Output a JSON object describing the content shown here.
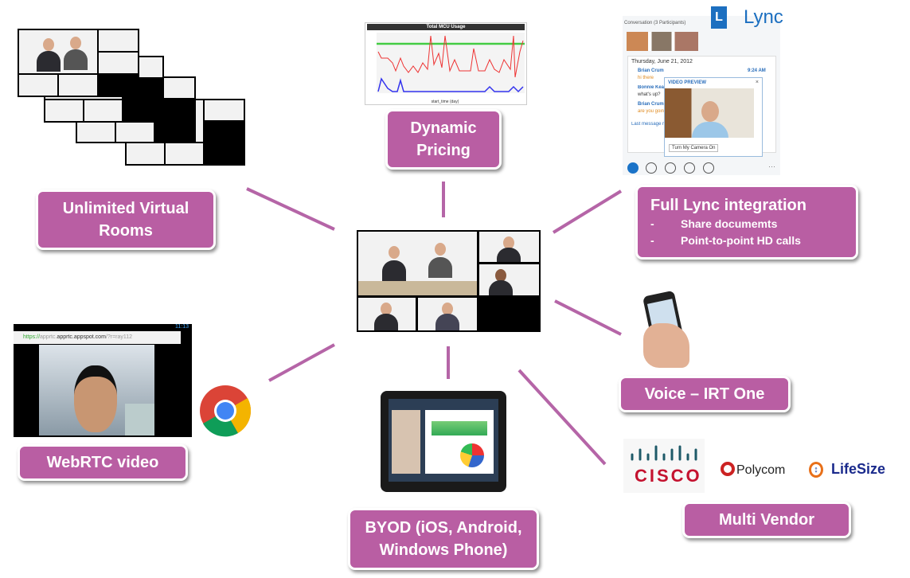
{
  "center": {
    "name": "video-conference-grid"
  },
  "labels": {
    "virtual_rooms": "Unlimited Virtual Rooms",
    "pricing": "Dynamic Pricing",
    "lync_title": "Full Lync integration",
    "lync_items": [
      "Share documemts",
      "Point-to-point HD calls"
    ],
    "lync_bullet": "-",
    "voice": "Voice – IRT One",
    "webrtc": "WebRTC video",
    "byod": "BYOD (iOS, Android, Windows Phone)",
    "multivendor": "Multi Vendor"
  },
  "chart": {
    "title": "Total MCU Usage",
    "xlabel": "start_time (day)",
    "yticks": [
      "12.5",
      "10.0",
      "7.5",
      "5.0",
      "2.5",
      "0.0"
    ],
    "xticks": [
      "01 May",
      "16 May",
      "01 Jun",
      "16 Jun",
      "01 Jul",
      "16 Jul",
      "01 Aug"
    ],
    "year": "2011"
  },
  "lync": {
    "logo": "Lync",
    "conversation": "Conversation (3 Participants)",
    "date": "Thursday, June 21, 2012",
    "sender1": "Brian Crum",
    "time1": "9:24 AM",
    "msg1": "hi there",
    "sender2": "Bonnie Kearney",
    "msg2": "what's up?",
    "msg3": "are you going",
    "preview_title": "VIDEO PREVIEW",
    "camera_button": "Turn My Camera On",
    "last_message": "Last message received"
  },
  "webrtc": {
    "url_https": "https://",
    "url_host": "apprtc.appspot.com",
    "url_rest": "/?r=ray112",
    "time": "11:13"
  },
  "vendors": {
    "cisco": "CISCO",
    "polycom": "Polycom",
    "lifesize": "LifeSize"
  },
  "colors": {
    "accent": "#b95ea3",
    "line": "#b565a7"
  }
}
